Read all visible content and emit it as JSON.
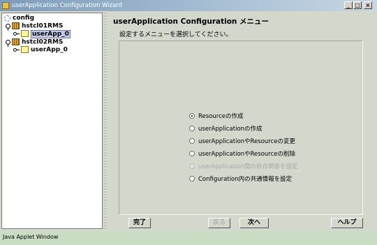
{
  "window": {
    "title": "userApplication Configuration Wizard",
    "buttons": {
      "minimize": "_",
      "maximize": "□",
      "close": "×"
    }
  },
  "tree": {
    "root": "config",
    "hosts": [
      {
        "name": "hstcl01RMS",
        "apps": [
          "userApp_0"
        ]
      },
      {
        "name": "hstcl02RMS",
        "apps": [
          "userApp_0"
        ]
      }
    ],
    "selected": "hstcl01RMS/userApp_0"
  },
  "main": {
    "heading": "userApplication Configuration メニュー",
    "subheading": "設定するメニューを選択してください。",
    "options": [
      {
        "label": "Resourceの作成",
        "checked": true,
        "enabled": true
      },
      {
        "label": "userApplicationの作成",
        "checked": false,
        "enabled": true
      },
      {
        "label": "userApplicationやResourceの変更",
        "checked": false,
        "enabled": true
      },
      {
        "label": "userApplicationやResourceの削除",
        "checked": false,
        "enabled": true
      },
      {
        "label": "userApplication間の依存関係を設定",
        "checked": false,
        "enabled": false
      },
      {
        "label": "Configuration内の共通情報を設定",
        "checked": false,
        "enabled": true
      }
    ]
  },
  "buttons": {
    "finish": "完了",
    "back": "戻る",
    "next": "次へ",
    "help": "ヘルプ"
  },
  "status": {
    "text": "Java Applet Window"
  }
}
